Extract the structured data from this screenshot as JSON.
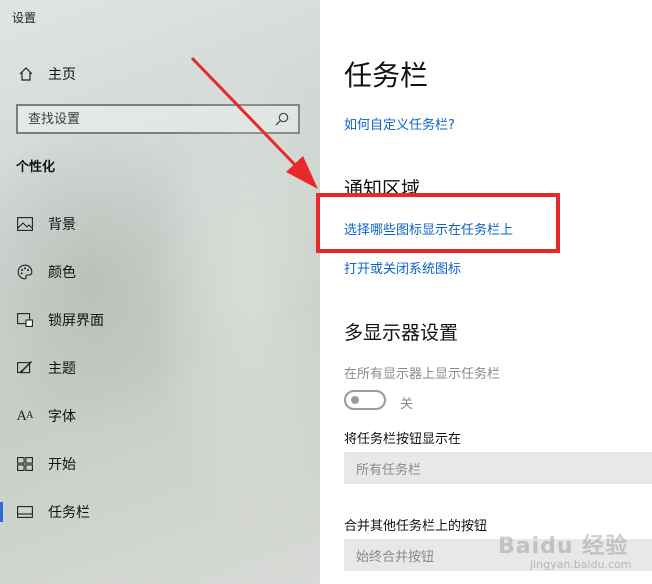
{
  "window": {
    "title": "设置"
  },
  "sidebar": {
    "home_label": "主页",
    "search_placeholder": "查找设置",
    "section_heading": "个性化",
    "items": [
      {
        "label": "背景",
        "icon": "picture-icon"
      },
      {
        "label": "颜色",
        "icon": "palette-icon"
      },
      {
        "label": "锁屏界面",
        "icon": "lock-screen-icon"
      },
      {
        "label": "主题",
        "icon": "theme-brush-icon"
      },
      {
        "label": "字体",
        "icon": "font-icon"
      },
      {
        "label": "开始",
        "icon": "start-grid-icon"
      },
      {
        "label": "任务栏",
        "icon": "taskbar-icon",
        "active": true
      }
    ]
  },
  "main": {
    "page_title": "任务栏",
    "help_link": "如何自定义任务栏?",
    "notification_area": {
      "heading": "通知区域",
      "link_select_icons": "选择哪些图标显示在任务栏上",
      "link_system_icons": "打开或关闭系统图标"
    },
    "multi_display": {
      "heading": "多显示器设置",
      "show_on_all_label": "在所有显示器上显示任务栏",
      "toggle_state": "关",
      "buttons_label": "将任务栏按钮显示在",
      "buttons_value": "所有任务栏",
      "combine_label": "合并其他任务栏上的按钮",
      "combine_value": "始终合并按钮"
    }
  },
  "annotation": {
    "highlight_color": "#e8292a"
  },
  "watermark": {
    "text": "Baidu 经验",
    "sub": "jingyan.baidu.com"
  },
  "colors": {
    "link": "#0a63c9",
    "accent": "#2a6cd9"
  }
}
